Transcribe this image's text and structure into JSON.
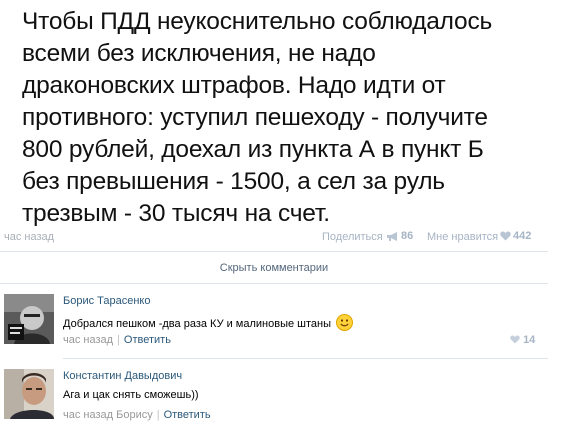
{
  "post": {
    "lines": [
      "Чтобы ПДД неукоснительно соблюдалось",
      "всеми без исключения, не надо",
      "драконовских штрафов. Надо идти от",
      "противного: уступил пешеходу - получите",
      "800 рублей, доехал из пункта А в пункт Б",
      "без превышения - 1500, а сел за руль",
      "трезвым - 30 тысяч на счет."
    ],
    "time": "час назад",
    "share_label": "Поделиться",
    "share_count": "86",
    "like_label": "Мне нравится",
    "like_count": "442"
  },
  "hide_comments_label": "Скрыть комментарии",
  "comments": [
    {
      "author": "Борис Тарасенко",
      "text": "Добрался пешком -два раза КУ и малиновые штаны",
      "time": "час назад",
      "reply_label": "Ответить",
      "likes": "14"
    },
    {
      "author": "Константин Давыдович",
      "text": "Ага и цак снять сможешь))",
      "time": "час назад Борису",
      "reply_label": "Ответить"
    }
  ],
  "colors": {
    "link": "#2b587a",
    "muted": "#999999",
    "counter": "#a7b4c4",
    "divider": "#dfe4ea"
  },
  "icons": {
    "share": "megaphone-icon",
    "like": "heart-icon",
    "smile": "smiley-emoji-icon"
  }
}
